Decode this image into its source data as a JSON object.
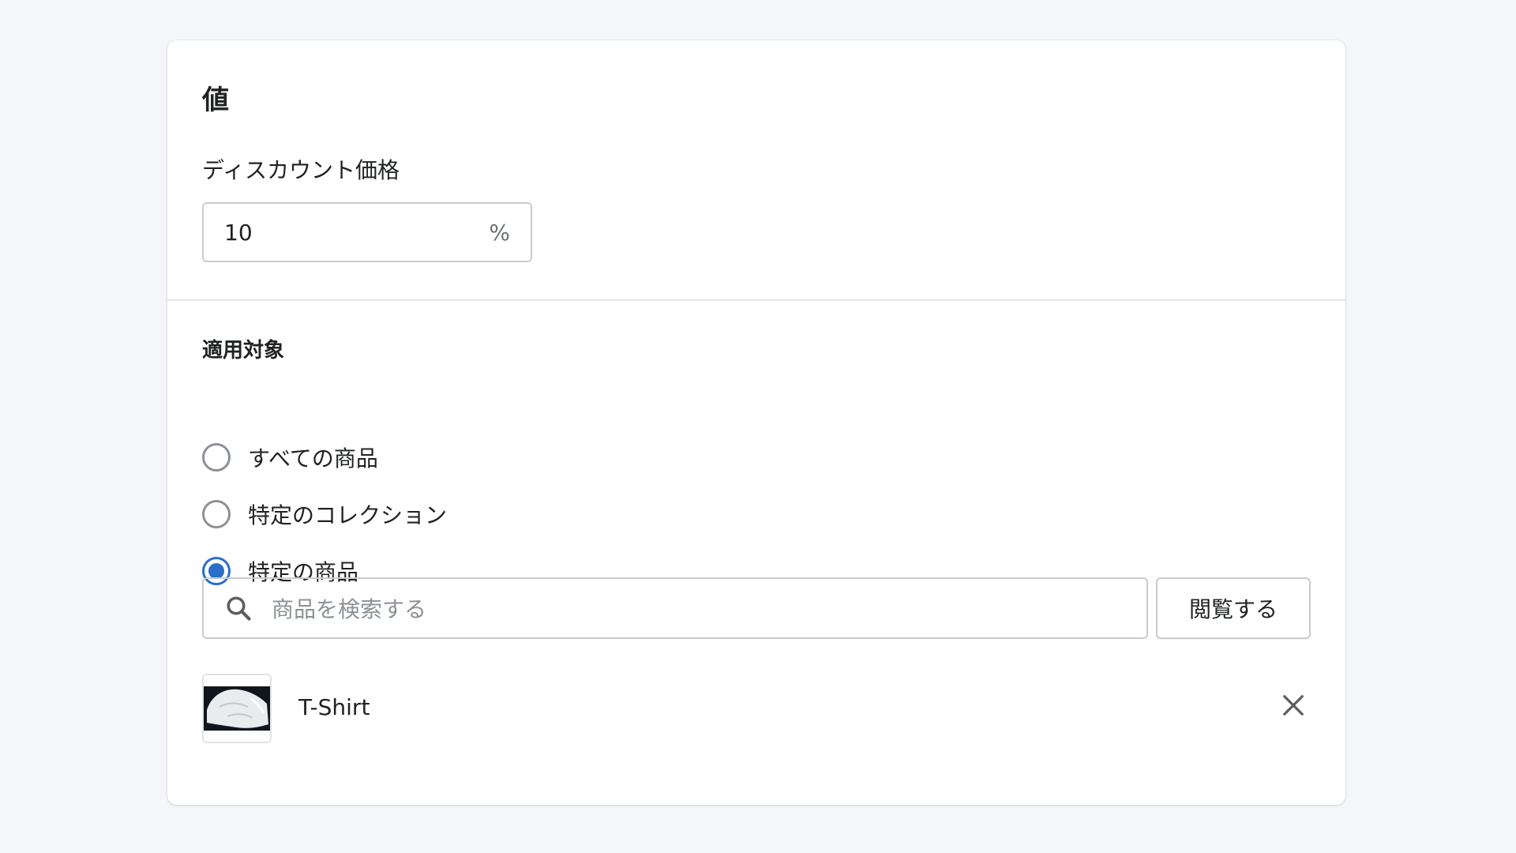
{
  "value_section": {
    "title": "値",
    "discount_label": "ディスカウント価格",
    "discount_value": "10",
    "discount_suffix": "%"
  },
  "applies_section": {
    "title": "適用対象",
    "options": [
      {
        "label": "すべての商品",
        "checked": false
      },
      {
        "label": "特定のコレクション",
        "checked": false
      },
      {
        "label": "特定の商品",
        "checked": true
      }
    ],
    "search_placeholder": "商品を検索する",
    "browse_label": "閲覧する",
    "selected_products": [
      {
        "name": "T-Shirt",
        "thumbnail_icon": "tshirt-thumbnail"
      }
    ]
  },
  "colors": {
    "accent": "#2c6ecb",
    "border": "#c9cccf",
    "background": "#f5f6f8"
  },
  "icons": {
    "search": "search-icon",
    "remove": "close-icon"
  }
}
